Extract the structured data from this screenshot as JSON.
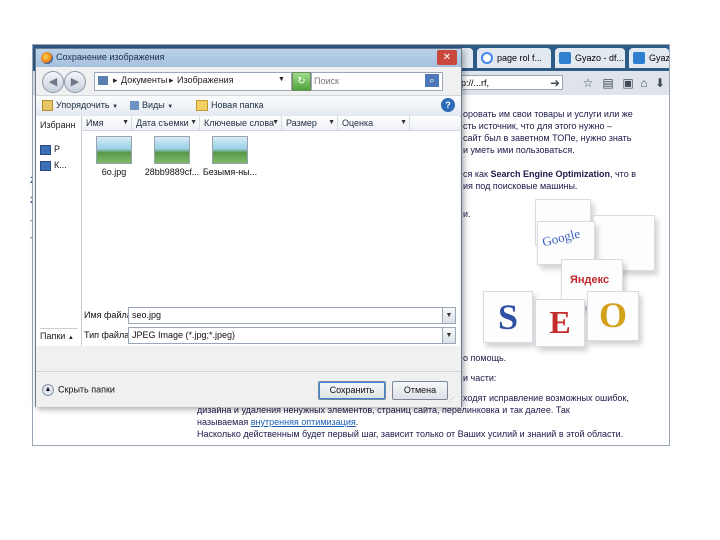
{
  "browser": {
    "tabs": [
      {
        "label": "..."
      },
      {
        "label": "page rol f..."
      },
      {
        "label": "Gyazo - df..."
      },
      {
        "label": "Gyazo"
      }
    ],
    "url": "ttp://...rf,",
    "article": {
      "lines": [
        "оровать им свои товары и услуги или же",
        "сть источник, что для этого нужно –",
        "сайт был в заветном ТОПе, нужно знать",
        "и уметь ими пользоваться.",
        "ся как Search Engine Optimization, что в",
        "ия под поисковые машины.",
        "и.",
        "о помощь.",
        "и части:",
        "ходят исправление возможных ошибок,",
        "дизайна и удаления ненужных элементов, страниц сайта, перелинковка и так далее. Так",
        "называемая внутренняя оптимизация.",
        "Насколько действенным будет первый шаг, зависит только от Ваших усилий и знаний в этой области."
      ],
      "bold_phrase": "Search Engine Optimization",
      "link_text": "внутренняя оптимизация"
    },
    "seo_graphic": {
      "letters": [
        "S",
        "E",
        "O"
      ],
      "brand_labels": [
        "Google",
        "Яндекс"
      ]
    }
  },
  "dialog": {
    "title": "Сохранение изображения",
    "path": [
      "Документы",
      "Изображения"
    ],
    "search_placeholder": "Поиск",
    "toolbar": {
      "organize": "Упорядочить",
      "views": "Виды",
      "new_folder": "Новая папка"
    },
    "nav": {
      "header": "Избранн",
      "items": [
        "P",
        "К..."
      ],
      "folders": "Папки"
    },
    "columns": [
      "Имя",
      "Дата съемки",
      "Ключевые слова",
      "Размер",
      "Оценка"
    ],
    "files": [
      {
        "name": "6o.jpg"
      },
      {
        "name": "28bb9889cf..."
      },
      {
        "name": "Безымя-ны..."
      }
    ],
    "filename_label": "Имя файла:",
    "filename_value": "seo.jpg",
    "filetype_label": "Тип файла:",
    "filetype_value": "JPEG Image (*.jpg;*.jpeg)",
    "hide_folders": "Скрыть папки",
    "save": "Сохранить",
    "cancel": "Отмена"
  },
  "colors": {
    "tabbar": "#2e5a86",
    "accent_blue": "#1a5fb4",
    "seo_s": "#2f4fa2",
    "seo_e": "#c42d2d",
    "seo_o": "#d2a21c"
  }
}
